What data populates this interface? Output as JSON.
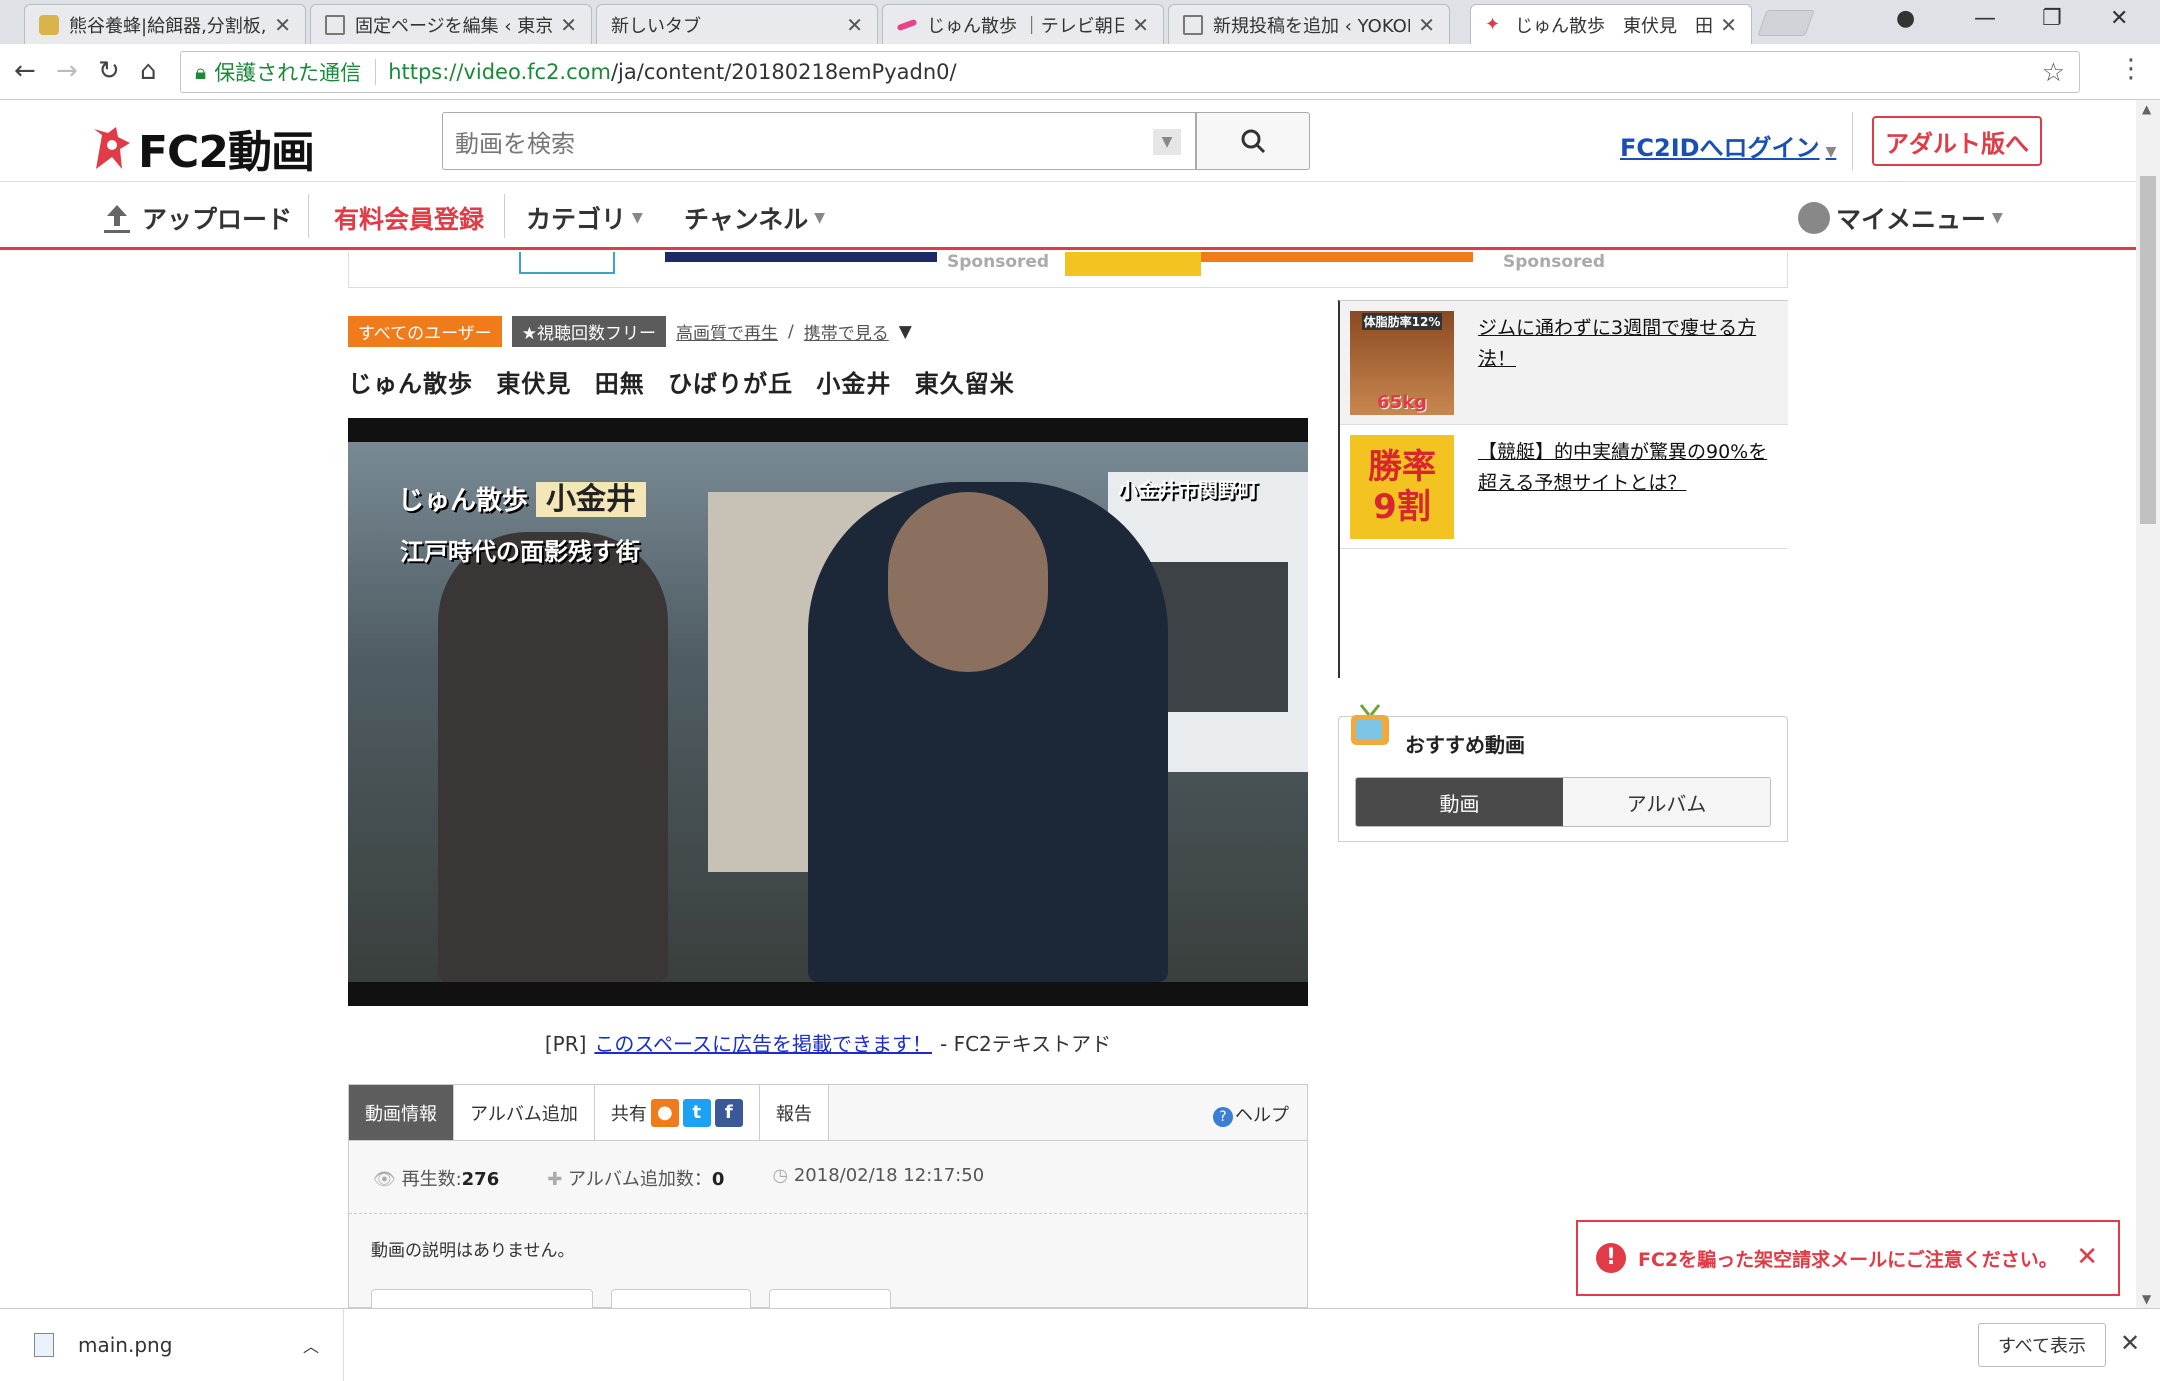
{
  "browser": {
    "tabs": [
      {
        "label": "熊谷養蜂|給餌器,分割板,"
      },
      {
        "label": "固定ページを編集 ‹ 東京で"
      },
      {
        "label": "新しいタブ"
      },
      {
        "label": "じゅん散歩 ｜テレビ朝日"
      },
      {
        "label": "新規投稿を追加 ‹ YOKOK"
      },
      {
        "label": "じゅん散歩　東伏見　田無"
      }
    ],
    "secure_label": "保護された通信",
    "url_host": "https://video.fc2.com",
    "url_path": "/ja/content/20180218emPyadn0/"
  },
  "header": {
    "logo_text": "FC2動画",
    "search_placeholder": "動画を検索",
    "login_label": "FC2IDへログイン",
    "adult_label": "アダルト版へ"
  },
  "nav": {
    "upload": "アップロード",
    "premium": "有料会員登録",
    "category": "カテゴリ",
    "channel": "チャンネル",
    "mymenu": "マイメニュー"
  },
  "banner": {
    "sponsored": "Sponsored"
  },
  "video": {
    "tag_all_users": "すべてのユーザー",
    "tag_free": "★視聴回数フリー",
    "hq_link": "高画質で再生",
    "slash": "/",
    "mobile_link": "携帯で見る",
    "mobile_caret": "▼",
    "title": "じゅん散歩 東伏見 田無 ひばりが丘 小金井 東久留米",
    "caption_logo": "じゅん散歩",
    "caption_place": "小金井",
    "caption_sub": "江戸時代の面影残す街",
    "caption_loc": "小金井市関野町"
  },
  "pr": {
    "prefix": "[PR]",
    "link": "このスペースに広告を掲載できます！",
    "suffix": "- FC2テキストアド"
  },
  "info": {
    "tabs": {
      "info": "動画情報",
      "album": "アルバム追加",
      "share": "共有",
      "report": "報告"
    },
    "help": "ヘルプ",
    "plays_label": "再生数:",
    "plays": "276",
    "album_count_label": "アルバム追加数：",
    "album_count": "0",
    "date": "2018/02/18 12:17:50",
    "description": "動画の説明はありません。"
  },
  "ads": [
    {
      "text": "ジムに通わずに3週間で痩せる方法！",
      "thumb_top": "体脂肪率12%",
      "thumb_bottom": "65kg"
    },
    {
      "text": "【競艇】的中実績が驚異の90%を超える予想サイトとは？",
      "thumb_top": "勝率",
      "thumb_bottom": "9割"
    }
  ],
  "recommend": {
    "title": "おすすめ動画",
    "tab_video": "動画",
    "tab_album": "アルバム"
  },
  "warning": {
    "text": "FC2を騙った架空請求メールにご注意ください。"
  },
  "downloads": {
    "filename": "main.png",
    "show_all": "すべて表示"
  },
  "colors": {
    "brand_red": "#e03b46",
    "link_blue": "#1b4fb3",
    "secure_green": "#1a8a39"
  }
}
